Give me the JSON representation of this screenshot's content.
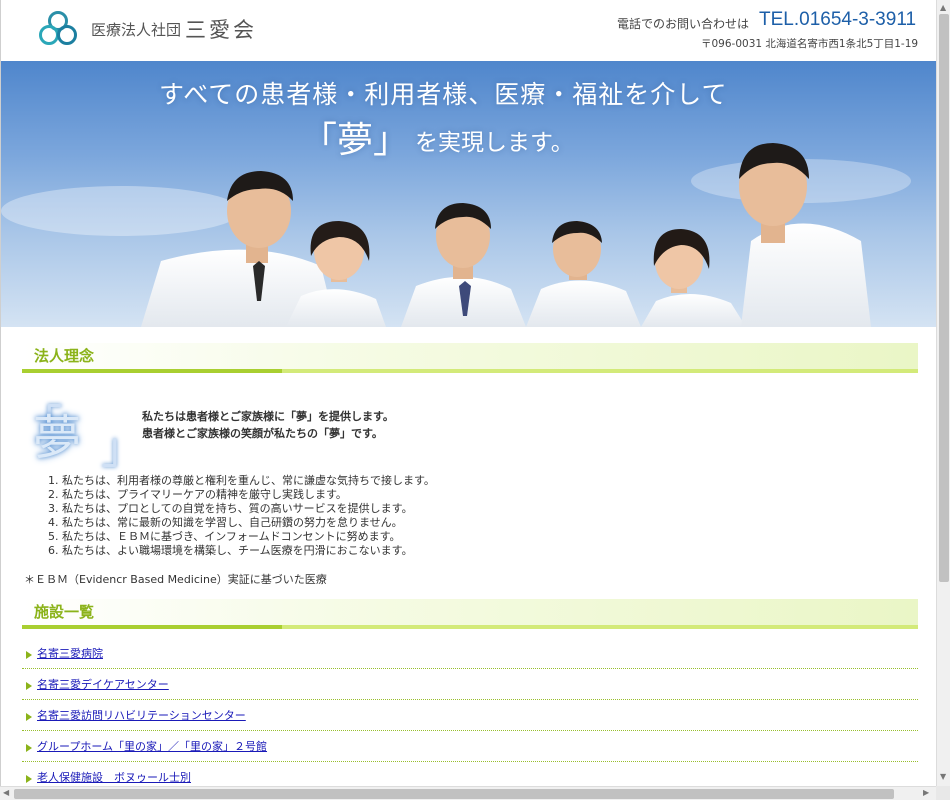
{
  "header": {
    "org_type": "医療法人社団",
    "org_name": "三愛会",
    "phone_label": "電話でのお問い合わせは",
    "phone_number": "TEL.01654-3-3911",
    "address": "〒096-0031 北海道名寄市西1条北5丁目1-19",
    "logo_icon": "trefoil-logo-icon"
  },
  "hero": {
    "line1": "すべての患者様・利用者様、医療・福祉を介して",
    "line2": "「夢」",
    "line3": "を実現します。"
  },
  "philosophy": {
    "heading": "法人理念",
    "yume": "夢",
    "mission_1": "私たちは患者様とご家族様に「夢」を提供します。",
    "mission_2": "患者様とご家族様の笑顔が私たちの「夢」です。",
    "principles": [
      {
        "num": "1.",
        "text": "私たちは、利用者様の尊厳と権利を重んじ、常に謙虚な気持ちで接します。"
      },
      {
        "num": "2.",
        "text": "私たちは、プライマリーケアの精神を厳守し実践します。"
      },
      {
        "num": "3.",
        "text": "私たちは、プロとしての自覚を持ち、質の高いサービスを提供します。"
      },
      {
        "num": "4.",
        "text": "私たちは、常に最新の知識を学習し、自己研鑽の努力を怠りません。"
      },
      {
        "num": "5.",
        "text": "私たちは、ＥＢＭに基づき、インフォームドコンセントに努めます。"
      },
      {
        "num": "6.",
        "text": "私たちは、よい職場環境を構築し、チーム医療を円滑におこないます。"
      }
    ],
    "ebm_note": "＊ＥＢＭ（Evidencr Based Medicine）実証に基づいた医療"
  },
  "facilities": {
    "heading": "施設一覧",
    "items": [
      "名寄三愛病院",
      "名寄三愛デイケアセンター",
      "名寄三愛訪問リハビリテーションセンター",
      "グループホーム「里の家」／「里の家」２号館",
      "老人保健施設　ボヌゥール士別"
    ]
  },
  "colors": {
    "accent_green": "#8bb31a",
    "phone_blue": "#1d5fa8",
    "link_blue": "#1a1ab8"
  }
}
